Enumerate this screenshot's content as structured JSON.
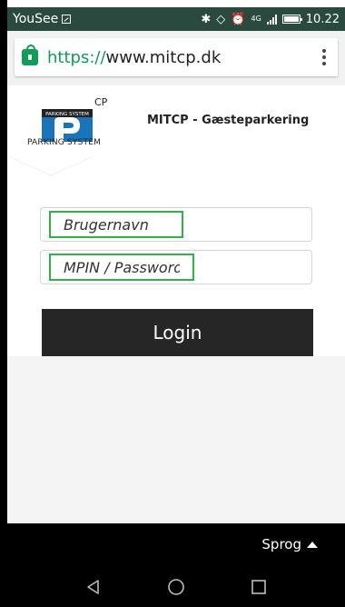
{
  "status_bar": {
    "carrier": "YouSee",
    "network": "4G",
    "time": "10.22"
  },
  "browser": {
    "url_scheme": "https://",
    "url_host": "www.mitcp.dk"
  },
  "header": {
    "logo_top_text": "PARKING SYSTEM",
    "logo_mark": "CP",
    "logo_caption": "PARKING SYSTEM",
    "title": "MITCP - Gæsteparkering"
  },
  "form": {
    "username_placeholder": "Brugernavn",
    "password_placeholder": "MPIN / Password",
    "login_label": "Login"
  },
  "footer": {
    "language_label": "Sprog"
  },
  "colors": {
    "status_bar": "#2a4a3f",
    "secure_green": "#0f9d58",
    "field_highlight": "#2fb24a",
    "login_button": "#262626",
    "logo_blue": "#1a74b8"
  }
}
